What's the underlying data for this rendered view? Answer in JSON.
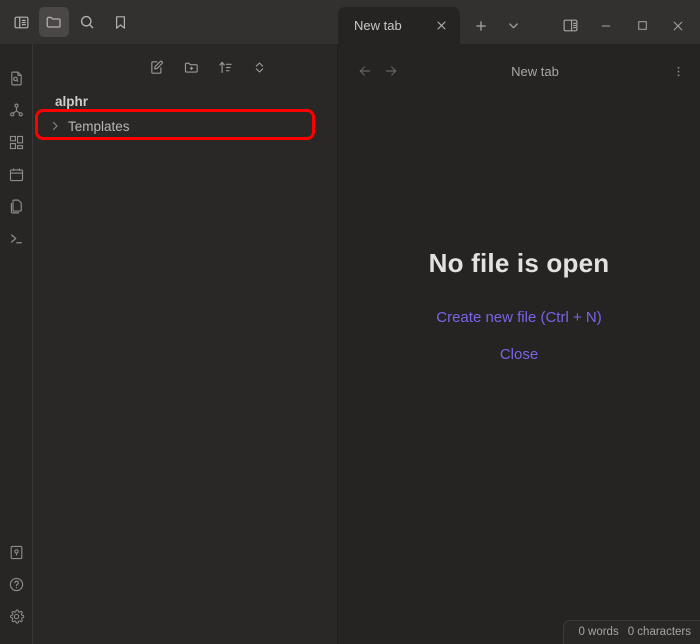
{
  "window": {
    "titlebar_buttons": [
      {
        "name": "toggle-left-sidebar",
        "icon": "sidebar-left-icon",
        "active": false
      },
      {
        "name": "files",
        "icon": "folder-icon",
        "active": true
      },
      {
        "name": "search",
        "icon": "search-icon",
        "active": false
      },
      {
        "name": "bookmarks",
        "icon": "bookmark-icon",
        "active": false
      }
    ],
    "tab": {
      "label": "New tab",
      "close_label": "Close tab"
    },
    "tab_actions": [
      {
        "name": "new-tab",
        "icon": "plus-icon"
      },
      {
        "name": "tab-list",
        "icon": "chevron-down-icon"
      }
    ],
    "controls": [
      {
        "name": "toggle-right-sidebar",
        "icon": "sidebar-right-icon"
      },
      {
        "name": "minimize",
        "icon": "minimize-icon"
      },
      {
        "name": "maximize",
        "icon": "maximize-icon"
      },
      {
        "name": "close-window",
        "icon": "close-icon"
      }
    ]
  },
  "rail": {
    "top_items": [
      {
        "name": "file-search",
        "icon": "file-search-icon"
      },
      {
        "name": "graph-view",
        "icon": "graph-icon"
      },
      {
        "name": "canvas",
        "icon": "grid-blocks-icon"
      },
      {
        "name": "daily-note",
        "icon": "calendar-icon"
      },
      {
        "name": "templates",
        "icon": "copy-files-icon"
      },
      {
        "name": "terminal",
        "icon": "terminal-icon"
      }
    ],
    "bottom_items": [
      {
        "name": "vault-switcher",
        "icon": "vault-icon"
      },
      {
        "name": "help",
        "icon": "help-circle-icon"
      },
      {
        "name": "settings",
        "icon": "gear-icon"
      }
    ]
  },
  "explorer": {
    "toolbar": [
      {
        "name": "new-note",
        "icon": "new-note-icon"
      },
      {
        "name": "new-folder",
        "icon": "new-folder-icon"
      },
      {
        "name": "change-sort-order",
        "icon": "sort-icon"
      },
      {
        "name": "collapse-expand-all",
        "icon": "collapse-expand-icon"
      }
    ],
    "vault_name": "alphr",
    "tree": [
      {
        "label": "Templates",
        "type": "folder",
        "expanded": false,
        "highlighted": true
      }
    ]
  },
  "main": {
    "view_title": "New tab",
    "nav": {
      "back": "Back",
      "forward": "Forward",
      "more": "More options"
    },
    "empty_state": {
      "title": "No file is open",
      "primary_action": "Create new file (Ctrl + N)",
      "secondary_action": "Close"
    },
    "statusbar": {
      "words": "0 words",
      "characters": "0 characters"
    }
  },
  "colors": {
    "accent_link": "#7a63e8",
    "annotation": "#fe0000",
    "top_bar": "#333130",
    "explorer_bg": "#2a2827",
    "editor_bg": "#262423"
  }
}
